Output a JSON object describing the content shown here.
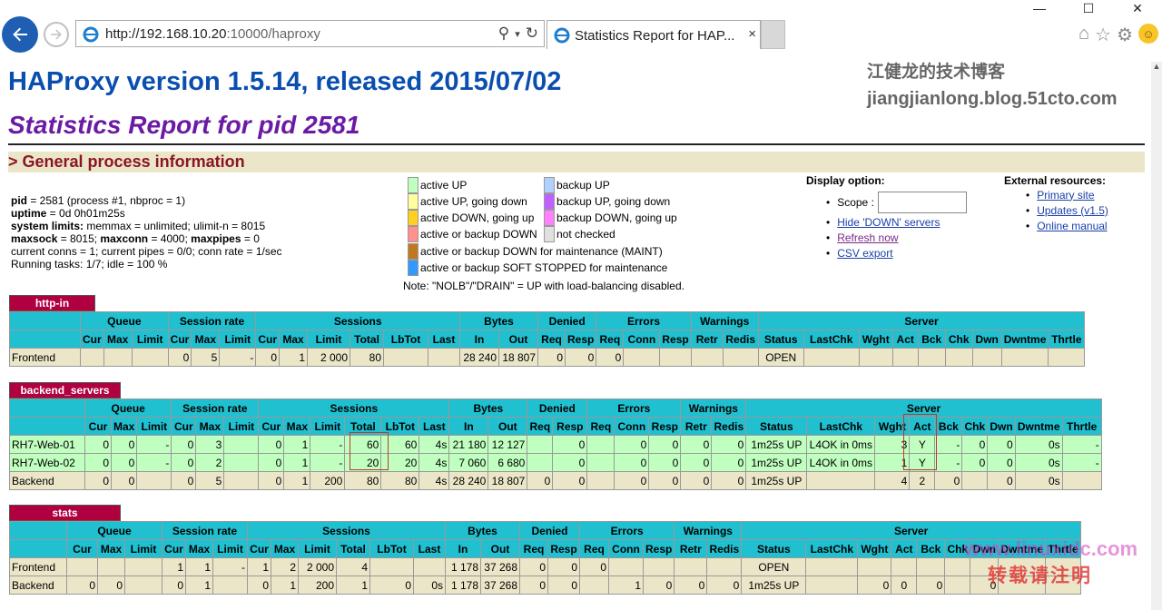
{
  "browser": {
    "url_host": "http://192.168.10.20",
    "url_rest": ":10000/haproxy",
    "tab_title": "Statistics Report for HAP...",
    "tab_close": "×",
    "win_min": "—",
    "win_max": "☐",
    "win_close": "✕"
  },
  "page": {
    "version_title": "HAProxy version 1.5.14, released 2015/07/02",
    "stats_title": "Statistics Report for pid 2581",
    "watermark_cn": "江健龙的技术博客",
    "watermark_url": "jiangjianlong.blog.51cto.com",
    "general_header": "> General process information"
  },
  "procinfo": {
    "pid_label": "pid",
    "pid_value": " = 2581 (process #1, nbproc = 1)",
    "uptime_label": "uptime",
    "uptime_value": " = 0d 0h01m25s",
    "syslimits_label": "system limits:",
    "syslimits_value": " memmax = unlimited; ulimit-n = 8015",
    "maxsock_label": "maxsock",
    "maxsock_value": " = 8015; ",
    "maxconn_label": "maxconn",
    "maxconn_value": " = 4000; ",
    "maxpipes_label": "maxpipes",
    "maxpipes_value": " = 0",
    "conns": "current conns = 1; current pipes = 0/0; conn rate = 1/sec",
    "tasks": "Running tasks: 1/7; idle = 100 %"
  },
  "legend": {
    "items": [
      {
        "label": "active UP",
        "color": "#c0ffc0"
      },
      {
        "label": "active UP, going down",
        "color": "#ffffa0"
      },
      {
        "label": "active DOWN, going up",
        "color": "#ffd020"
      },
      {
        "label": "active or backup DOWN",
        "color": "#ff9090"
      },
      {
        "label": "active or backup DOWN for maintenance (MAINT)",
        "color": "#c07820"
      },
      {
        "label": "active or backup SOFT STOPPED for maintenance",
        "color": "#3399ff"
      },
      {
        "label": "backup UP",
        "color": "#b0d0ff"
      },
      {
        "label": "backup UP, going down",
        "color": "#c060ff"
      },
      {
        "label": "backup DOWN, going up",
        "color": "#ff80ff"
      },
      {
        "label": "not checked",
        "color": "#e0e0e0"
      }
    ],
    "note": "Note: \"NOLB\"/\"DRAIN\" = UP with load-balancing disabled."
  },
  "display": {
    "title": "Display option:",
    "scope": "Scope :",
    "hide_down": "Hide 'DOWN' servers",
    "refresh": "Refresh now",
    "csv": "CSV export"
  },
  "external": {
    "title": "External resources:",
    "primary": "Primary site",
    "updates": "Updates (v1.5)",
    "manual": "Online manual"
  },
  "groups": [
    "",
    "Queue",
    "Session rate",
    "Sessions",
    "Bytes",
    "Denied",
    "Errors",
    "Warnings",
    "Server"
  ],
  "columns": [
    "",
    "Cur",
    "Max",
    "Limit",
    "Cur",
    "Max",
    "Limit",
    "Cur",
    "Max",
    "Limit",
    "Total",
    "LbTot",
    "Last",
    "In",
    "Out",
    "Req",
    "Resp",
    "Req",
    "Conn",
    "Resp",
    "Retr",
    "Redis",
    "Status",
    "LastChk",
    "Wght",
    "Act",
    "Bck",
    "Chk",
    "Dwn",
    "Dwntme",
    "Thrtle"
  ],
  "proxies": [
    {
      "name": "http-in",
      "rows": [
        {
          "type": "fe",
          "cells": [
            "Frontend",
            "",
            "",
            "",
            "0",
            "5",
            "-",
            "0",
            "1",
            "2 000",
            "80",
            "",
            "",
            "28 240",
            "18 807",
            "0",
            "0",
            "0",
            "",
            "",
            "",
            "",
            "OPEN",
            "",
            "",
            "",
            "",
            "",
            "",
            "",
            ""
          ]
        }
      ]
    },
    {
      "name": "backend_servers",
      "rows": [
        {
          "type": "up",
          "cells": [
            "RH7-Web-01",
            "0",
            "0",
            "-",
            "0",
            "3",
            "",
            "0",
            "1",
            "-",
            "60",
            "60",
            "4s",
            "21 180",
            "12 127",
            "",
            "0",
            "",
            "0",
            "0",
            "0",
            "0",
            "1m25s UP",
            "L4OK in 0ms",
            "3",
            "Y",
            "-",
            "0",
            "0",
            "0s",
            "-"
          ]
        },
        {
          "type": "up",
          "cells": [
            "RH7-Web-02",
            "0",
            "0",
            "-",
            "0",
            "2",
            "",
            "0",
            "1",
            "-",
            "20",
            "20",
            "4s",
            "7 060",
            "6 680",
            "",
            "0",
            "",
            "0",
            "0",
            "0",
            "0",
            "1m25s UP",
            "L4OK in 0ms",
            "1",
            "Y",
            "-",
            "0",
            "0",
            "0s",
            "-"
          ]
        },
        {
          "type": "be",
          "cells": [
            "Backend",
            "0",
            "0",
            "",
            "0",
            "5",
            "",
            "0",
            "1",
            "200",
            "80",
            "80",
            "4s",
            "28 240",
            "18 807",
            "0",
            "0",
            "",
            "0",
            "0",
            "0",
            "0",
            "1m25s UP",
            "",
            "4",
            "2",
            "0",
            "",
            "0",
            "0s",
            ""
          ]
        }
      ]
    },
    {
      "name": "stats",
      "rows": [
        {
          "type": "fe",
          "cells": [
            "Frontend",
            "",
            "",
            "",
            "1",
            "1",
            "-",
            "1",
            "2",
            "2 000",
            "4",
            "",
            "",
            "1 178",
            "37 268",
            "0",
            "0",
            "0",
            "",
            "",
            "",
            "",
            "OPEN",
            "",
            "",
            "",
            "",
            "",
            "",
            "",
            ""
          ]
        },
        {
          "type": "be",
          "cells": [
            "Backend",
            "0",
            "0",
            "",
            "0",
            "1",
            "",
            "0",
            "1",
            "200",
            "1",
            "0",
            "0s",
            "1 178",
            "37 268",
            "0",
            "0",
            "",
            "1",
            "0",
            "0",
            "0",
            "1m25s UP",
            "",
            "0",
            "0",
            "0",
            "",
            "0",
            "",
            ""
          ]
        }
      ]
    }
  ],
  "watermark_bottom1": "www.linuxidc.com",
  "watermark_bottom2": "转载请注明"
}
